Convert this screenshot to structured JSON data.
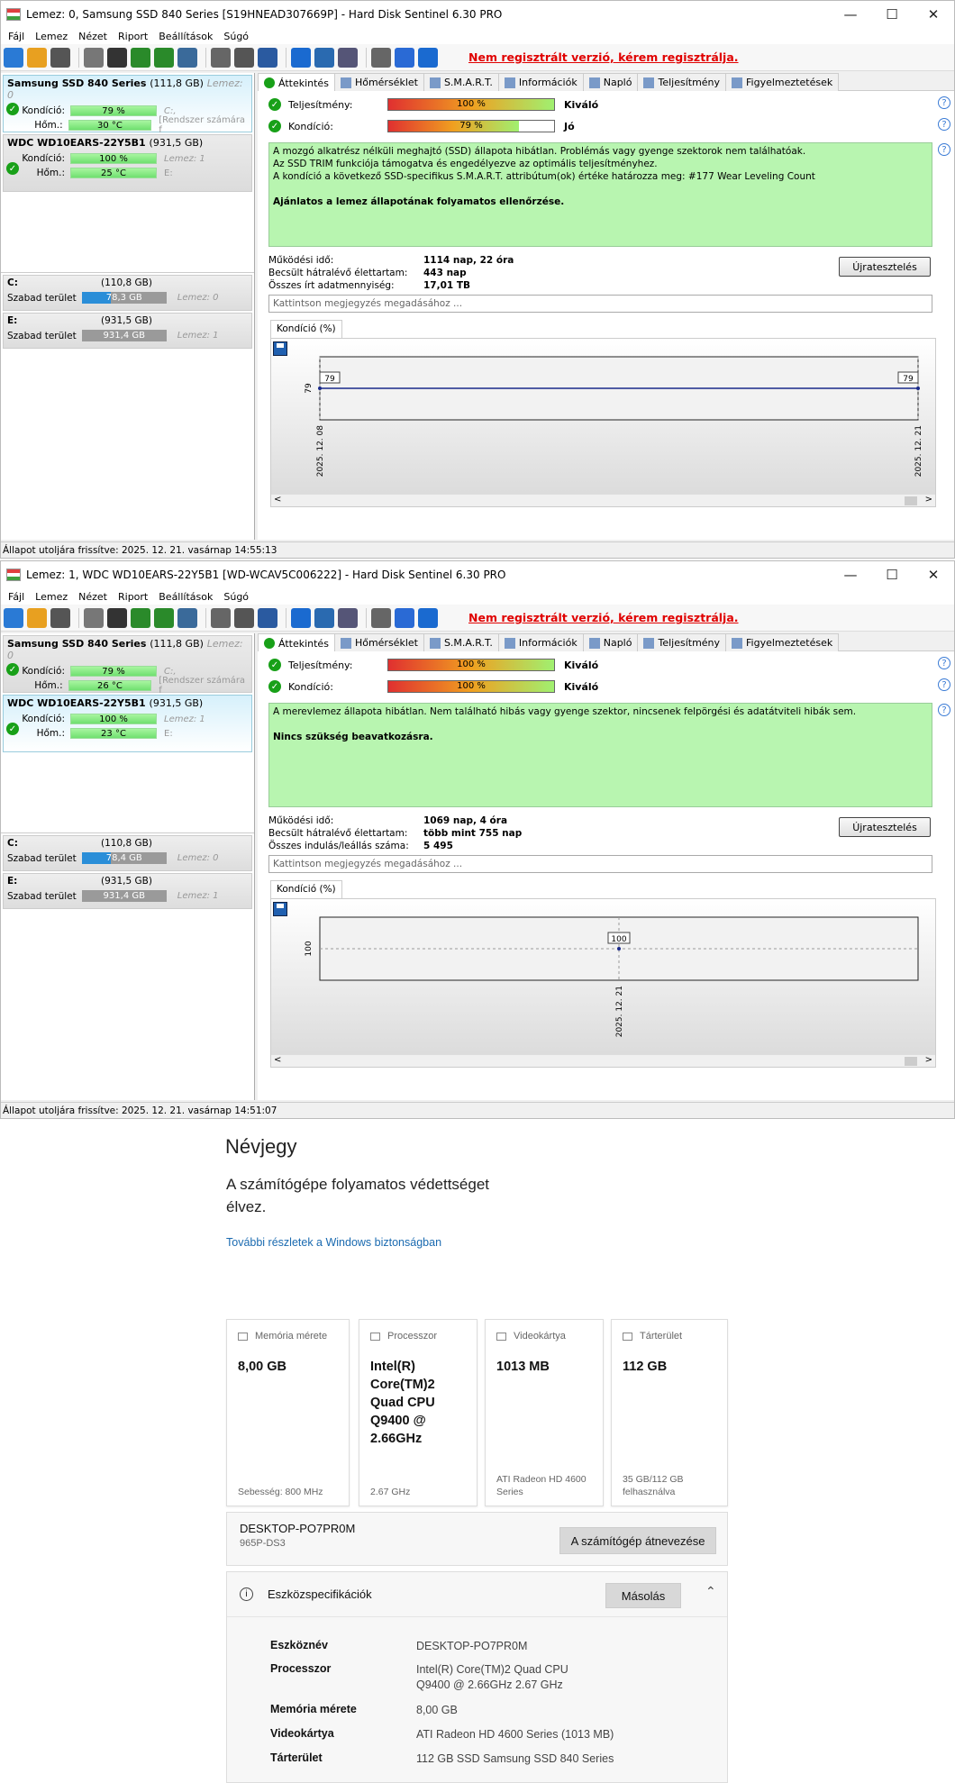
{
  "windows": [
    {
      "title": "Lemez: 0, Samsung SSD 840 Series [S19HNEAD307669P]  -  Hard Disk Sentinel 6.30 PRO",
      "menu": [
        "Fájl",
        "Lemez",
        "Nézet",
        "Riport",
        "Beállítások",
        "Súgó"
      ],
      "reg_text": "Nem regisztrált verzió, kérem regisztrálja.",
      "disks": [
        {
          "name": "Samsung SSD 840 Series",
          "size": "(111,8 GB)",
          "lemez": "Lemez: 0",
          "cond_label": "Kondíció:",
          "cond": "79 %",
          "temp_label": "Hőm.:",
          "temp": "30 °C",
          "aux1": "C:,",
          "aux2": "[Rendszer számára f",
          "selected": true
        },
        {
          "name": "WDC WD10EARS-22Y5B1",
          "size": "(931,5 GB)",
          "lemez": "",
          "cond_label": "Kondíció:",
          "cond": "100 %",
          "temp_label": "Hőm.:",
          "temp": "25 °C",
          "aux1": "Lemez: 1",
          "aux2": "E:",
          "selected": false
        }
      ],
      "volumes": [
        {
          "letter": "C:",
          "size": "(110,8 GB)",
          "free_label": "Szabad terület",
          "free": "78,3 GB",
          "lemez": "Lemez: 0",
          "color": "blue"
        },
        {
          "letter": "E:",
          "size": "(931,5 GB)",
          "free_label": "Szabad terület",
          "free": "931,4 GB",
          "lemez": "Lemez: 1",
          "color": "gray"
        }
      ],
      "tabs": [
        "Áttekintés",
        "Hőmérséklet",
        "S.M.A.R.T.",
        "Információk",
        "Napló",
        "Teljesítmény",
        "Figyelmeztetések"
      ],
      "perf_label": "Teljesítmény:",
      "perf_pct": "100 %",
      "perf_value": 100,
      "perf_text": "Kiváló",
      "cond_label": "Kondíció:",
      "cond_pct": "79 %",
      "cond_value": 79,
      "cond_text": "Jó",
      "status_lines": [
        "A mozgó alkatrész nélküli meghajtó (SSD) állapota hibátlan. Problémás vagy gyenge szektorok nem találhatóak.",
        "Az SSD TRIM funkciója támogatva és engedélyezve az optimális teljesítményhez.",
        "A kondíció a következő SSD-specifikus S.M.A.R.T. attribútum(ok) értéke határozza meg:  #177 Wear Leveling Count"
      ],
      "status_bold": "Ajánlatos a lemez állapotának folyamatos ellenőrzése.",
      "stats": [
        {
          "k": "Működési idő:",
          "v": "1114 nap, 22 óra"
        },
        {
          "k": "Becsült hátralévő élettartam:",
          "v": "443 nap"
        },
        {
          "k": "Összes írt adatmennyiség:",
          "v": "17,01 TB"
        }
      ],
      "restart_label": "Újratesztelés",
      "note_placeholder": "Kattintson megjegyzés megadásához ...",
      "chart_tab": "Kondíció  (%)",
      "statusbar": "Állapot utoljára frissítve: 2025. 12. 21. vasárnap 14:55:13"
    },
    {
      "title": "Lemez: 1, WDC WD10EARS-22Y5B1 [WD-WCAV5C006222]  -  Hard Disk Sentinel 6.30 PRO",
      "menu": [
        "Fájl",
        "Lemez",
        "Nézet",
        "Riport",
        "Beállítások",
        "Súgó"
      ],
      "reg_text": "Nem regisztrált verzió, kérem regisztrálja.",
      "disks": [
        {
          "name": "Samsung SSD 840 Series",
          "size": "(111,8 GB)",
          "lemez": "Lemez: 0",
          "cond_label": "Kondíció:",
          "cond": "79 %",
          "temp_label": "Hőm.:",
          "temp": "26 °C",
          "aux1": "C:,",
          "aux2": "[Rendszer számára f",
          "selected": false
        },
        {
          "name": "WDC WD10EARS-22Y5B1",
          "size": "(931,5 GB)",
          "lemez": "",
          "cond_label": "Kondíció:",
          "cond": "100 %",
          "temp_label": "Hőm.:",
          "temp": "23 °C",
          "aux1": "Lemez: 1",
          "aux2": "E:",
          "selected": true
        }
      ],
      "volumes": [
        {
          "letter": "C:",
          "size": "(110,8 GB)",
          "free_label": "Szabad terület",
          "free": "78,4 GB",
          "lemez": "Lemez: 0",
          "color": "blue"
        },
        {
          "letter": "E:",
          "size": "(931,5 GB)",
          "free_label": "Szabad terület",
          "free": "931,4 GB",
          "lemez": "Lemez: 1",
          "color": "gray"
        }
      ],
      "tabs": [
        "Áttekintés",
        "Hőmérséklet",
        "S.M.A.R.T.",
        "Információk",
        "Napló",
        "Teljesítmény",
        "Figyelmeztetések"
      ],
      "perf_label": "Teljesítmény:",
      "perf_pct": "100 %",
      "perf_value": 100,
      "perf_text": "Kiváló",
      "cond_label": "Kondíció:",
      "cond_pct": "100 %",
      "cond_value": 100,
      "cond_text": "Kiváló",
      "status_lines": [
        "A merevlemez állapota hibátlan. Nem található hibás vagy gyenge szektor, nincsenek felpörgési és adatátviteli hibák sem."
      ],
      "status_bold": "Nincs szükség beavatkozásra.",
      "stats": [
        {
          "k": "Működési idő:",
          "v": "1069 nap, 4 óra"
        },
        {
          "k": "Becsült hátralévő élettartam:",
          "v": "több mint 755 nap"
        },
        {
          "k": "Összes indulás/leállás száma:",
          "v": "5 495"
        }
      ],
      "restart_label": "Újratesztelés",
      "note_placeholder": "Kattintson megjegyzés megadásához ...",
      "chart_tab": "Kondíció  (%)",
      "statusbar": "Állapot utoljára frissítve: 2025. 12. 21. vasárnap 14:51:07"
    }
  ],
  "chart_data": [
    {
      "type": "line",
      "x": [
        "2025. 12. 08",
        "2025. 12. 21"
      ],
      "values": [
        79,
        79
      ],
      "point_labels": [
        "79",
        "79"
      ],
      "ylabel": "79"
    },
    {
      "type": "scatter",
      "x": [
        "2025. 12. 21"
      ],
      "values": [
        100
      ],
      "point_labels": [
        "100"
      ],
      "ylabel": "100"
    }
  ],
  "settings": {
    "title": "Névjegy",
    "protect_msg": "A számítógépe folyamatos védettséget élvez.",
    "link": "További részletek a Windows biztonságban",
    "cards": [
      {
        "head": "Memória mérete",
        "value": "8,00 GB",
        "sub": "Sebesség: 800 MHz"
      },
      {
        "head": "Processzor",
        "value": "Intel(R) Core(TM)2 Quad CPU Q9400 @ 2.66GHz",
        "sub": "2.67 GHz"
      },
      {
        "head": "Videokártya",
        "value": "1013 MB",
        "sub": "ATI Radeon HD 4600 Series"
      },
      {
        "head": "Tárterület",
        "value": "112 GB",
        "sub": "35 GB/112 GB felhasználva"
      }
    ],
    "pc_name": "DESKTOP-PO7PR0M",
    "pc_model": "965P-DS3",
    "rename_label": "A számítógép átnevezése",
    "spec_title": "Eszközspecifikációk",
    "copy_label": "Másolás",
    "specs": [
      {
        "k": "Eszköznév",
        "v": "DESKTOP-PO7PR0M"
      },
      {
        "k": "Processzor",
        "v": "Intel(R) Core(TM)2 Quad CPU    Q9400  @ 2.66GHz   2.67 GHz"
      },
      {
        "k": "Memória mérete",
        "v": "8,00 GB"
      },
      {
        "k": "Videokártya",
        "v": "ATI Radeon HD 4600 Series (1013 MB)"
      },
      {
        "k": "Tárterület",
        "v": "112 GB SSD Samsung SSD 840 Series"
      }
    ]
  }
}
